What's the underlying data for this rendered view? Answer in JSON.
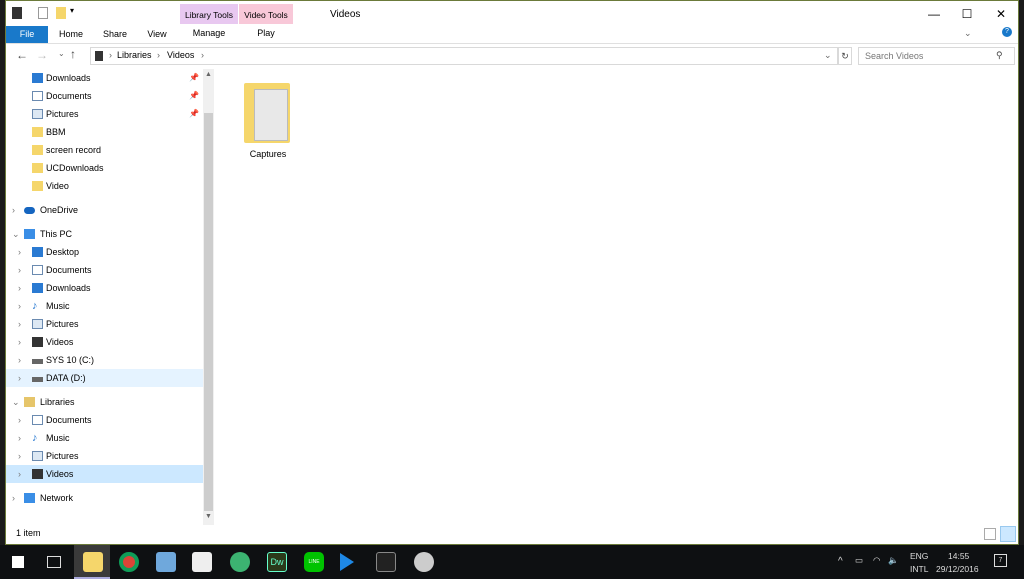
{
  "window": {
    "title": "Videos",
    "minimize": "—",
    "maximize": "☐",
    "close": "✕"
  },
  "ribbon": {
    "file": "File",
    "tabs": [
      "Home",
      "Share",
      "View"
    ],
    "library_tools": "Library Tools",
    "manage": "Manage",
    "video_tools": "Video Tools",
    "play": "Play",
    "colors": {
      "file": "#1979ca",
      "library": "#e8c8f0",
      "video": "#f8c8d8"
    }
  },
  "address": {
    "breadcrumb": [
      "Libraries",
      "Videos"
    ],
    "search_placeholder": "Search Videos"
  },
  "nav": {
    "quick": [
      {
        "label": "Downloads",
        "pinned": true
      },
      {
        "label": "Documents",
        "pinned": true
      },
      {
        "label": "Pictures",
        "pinned": true
      },
      {
        "label": "BBM"
      },
      {
        "label": "screen record"
      },
      {
        "label": "UCDownloads"
      },
      {
        "label": "Video"
      }
    ],
    "onedrive": "OneDrive",
    "thispc": "This PC",
    "pc_items": [
      "Desktop",
      "Documents",
      "Downloads",
      "Music",
      "Pictures",
      "Videos",
      "SYS 10 (C:)",
      "DATA (D:)"
    ],
    "libraries": "Libraries",
    "lib_items": [
      "Documents",
      "Music",
      "Pictures",
      "Videos"
    ],
    "network": "Network"
  },
  "content": {
    "items": [
      {
        "name": "Captures"
      }
    ]
  },
  "status": {
    "count": "1 item"
  },
  "taskbar": {
    "lang1": "ENG",
    "lang2": "INTL",
    "time": "14:55",
    "date": "29/12/2016",
    "notifications": "7",
    "dw": "Dw",
    "line": "LINE"
  }
}
